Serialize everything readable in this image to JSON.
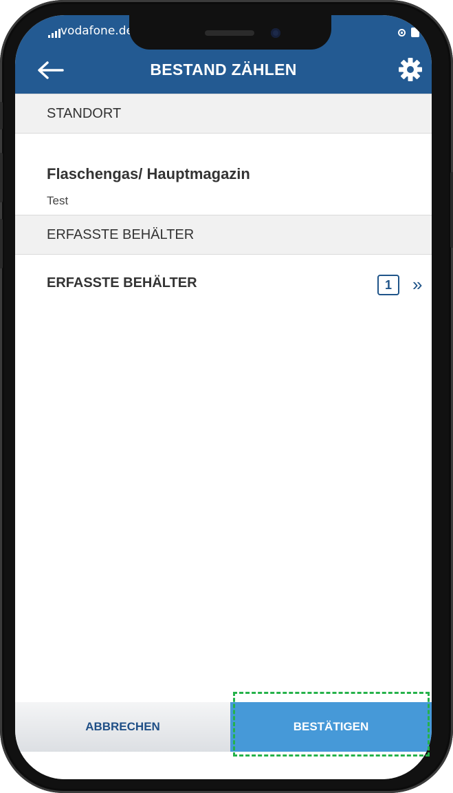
{
  "status_bar": {
    "carrier": "vodafone.de",
    "signal_icon": "signal-bars-icon",
    "right_icons": [
      "rotation-lock-icon",
      "battery-icon"
    ]
  },
  "header": {
    "back_icon": "arrow-left-icon",
    "title": "BESTAND ZÄHLEN",
    "settings_icon": "gear-icon",
    "background_color": "#235a92"
  },
  "sections": {
    "standort": {
      "header": "STANDORT",
      "location_name": "Flaschengas/ Hauptmagazin",
      "location_sub": "Test"
    },
    "behaelter": {
      "header": "ERFASSTE BEHÄLTER",
      "row_label": "ERFASSTE BEHÄLTER",
      "count": "1",
      "chevron": "»"
    }
  },
  "footer": {
    "cancel_label": "ABBRECHEN",
    "confirm_label": "BESTÄTIGEN",
    "confirm_color": "#4699d8",
    "highlight_color": "#25b24a"
  }
}
